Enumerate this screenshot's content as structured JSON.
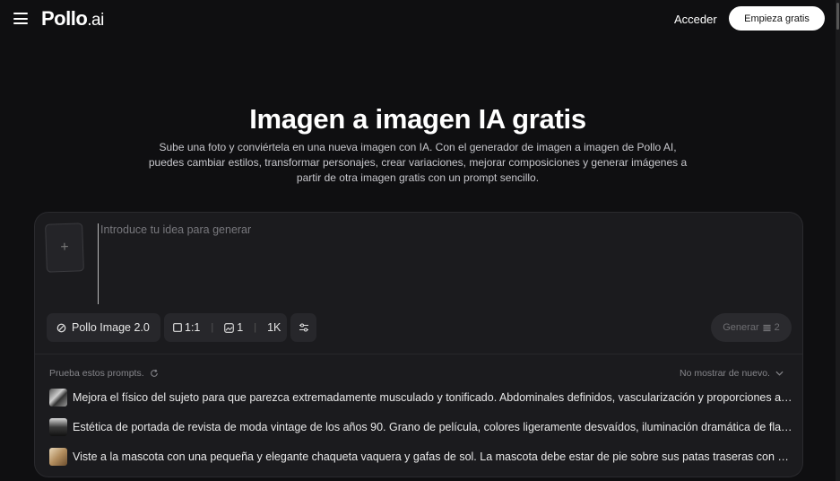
{
  "header": {
    "logo_main": "Pollo",
    "logo_suffix": ".ai",
    "login_label": "Acceder",
    "cta_label": "Empieza gratis"
  },
  "hero": {
    "title": "Imagen a imagen IA gratis",
    "subtitle": "Sube una foto y conviértela en una nueva imagen con IA. Con el generador de imagen a imagen de Pollo AI, puedes cambiar estilos, transformar personajes, crear variaciones, mejorar composiciones y generar imágenes a partir de otra imagen gratis con un prompt sencillo."
  },
  "generator": {
    "upload_symbol": "+",
    "prompt_placeholder": "Introduce tu idea para generar",
    "model_label": "Pollo Image 2.0",
    "aspect_ratio": "1:1",
    "image_count": "1",
    "resolution": "1K",
    "generate_label": "Generar",
    "generate_cost": "2"
  },
  "suggestions": {
    "label": "Prueba estos prompts.",
    "dismiss_label": "No mostrar de nuevo.",
    "items": [
      {
        "text": "Mejora el físico del sujeto para que parezca extremadamente musculado y tonificado. Abdominales definidos, vascularización y proporciones armoniosas."
      },
      {
        "text": "Estética de portada de revista de moda vintage de los años 90. Grano de película, colores ligeramente desvaídos, iluminación dramática de flash."
      },
      {
        "text": "Viste a la mascota con una pequeña y elegante chaqueta vaquera y gafas de sol. La mascota debe estar de pie sobre sus patas traseras con confianza."
      }
    ]
  },
  "icons": [
    "menu-icon",
    "model-icon",
    "aspect-ratio-icon",
    "image-count-icon",
    "settings-sliders-icon",
    "credits-icon",
    "refresh-icon",
    "chevron-down-icon"
  ]
}
